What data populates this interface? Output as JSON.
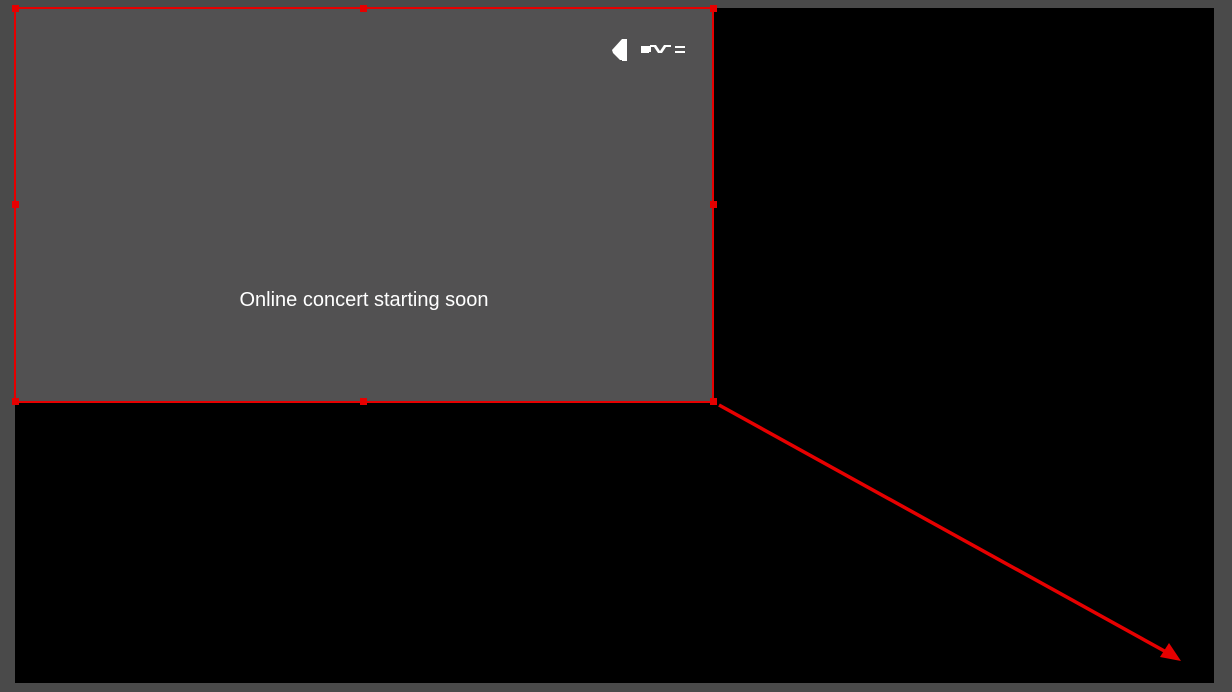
{
  "scene": {
    "caption": "Online concert starting soon",
    "logo_icon": "brand-logo-icon",
    "selection_color": "#e60000",
    "canvas_color": "#000000",
    "source_background": "#525152",
    "workspace_background": "#4a4a4a"
  }
}
